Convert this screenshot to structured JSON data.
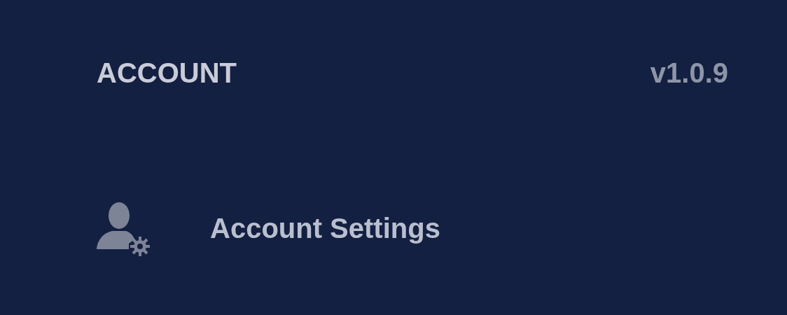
{
  "section": {
    "title": "ACCOUNT",
    "version": "v1.0.9"
  },
  "items": [
    {
      "label": "Account Settings"
    }
  ]
}
